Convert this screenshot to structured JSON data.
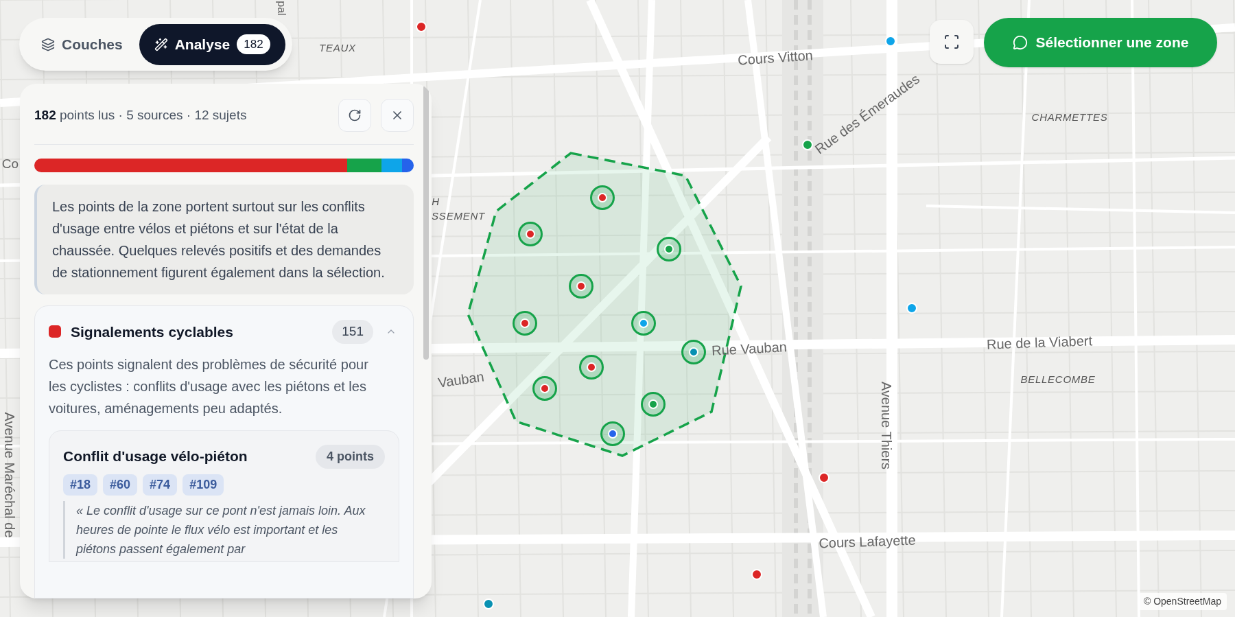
{
  "tabs": [
    {
      "kind": "layers",
      "label": "Couches",
      "selected": false
    },
    {
      "kind": "analysis",
      "label": "Analyse",
      "count": "182",
      "selected": true
    }
  ],
  "toolbar": {
    "select_zone": "Sélectionner une zone"
  },
  "map": {
    "labels": [
      {
        "text": "TEAUX",
        "kind": "district"
      },
      {
        "text": "pal",
        "kind": "street"
      },
      {
        "text": "Cours Vitton",
        "kind": "street"
      },
      {
        "text": "Rue des Émeraudes",
        "kind": "street"
      },
      {
        "text": "CHARMETTES",
        "kind": "district"
      },
      {
        "text": "Co",
        "kind": "street"
      },
      {
        "text": "H",
        "kind": "district"
      },
      {
        "text": "SSEMENT",
        "kind": "district"
      },
      {
        "text": "Vauban",
        "kind": "street"
      },
      {
        "text": "Rue Vauban",
        "kind": "street"
      },
      {
        "text": "Rue de la Viabert",
        "kind": "street"
      },
      {
        "text": "BELLECOMBE",
        "kind": "district"
      },
      {
        "text": "Avenue Thiers",
        "kind": "street"
      },
      {
        "text": "Cours Lafayette",
        "kind": "street"
      },
      {
        "text": "Avenue Maréchal de",
        "kind": "street"
      }
    ],
    "points": [
      {
        "color": "#dc2626",
        "selected": false
      },
      {
        "color": "#0ea5e9",
        "selected": false
      },
      {
        "color": "#16a34a",
        "selected": false
      },
      {
        "color": "#0ea5e9",
        "selected": false
      },
      {
        "color": "#dc2626",
        "selected": false
      },
      {
        "color": "#dc2626",
        "selected": false
      },
      {
        "color": "#0891b2",
        "selected": false
      },
      {
        "color": "#dc2626",
        "selected": true
      },
      {
        "color": "#dc2626",
        "selected": true
      },
      {
        "color": "#16a34a",
        "selected": true
      },
      {
        "color": "#dc2626",
        "selected": true
      },
      {
        "color": "#dc2626",
        "selected": true
      },
      {
        "color": "#0ea5e9",
        "selected": true
      },
      {
        "color": "#0891b2",
        "selected": true
      },
      {
        "color": "#dc2626",
        "selected": true
      },
      {
        "color": "#dc2626",
        "selected": true
      },
      {
        "color": "#16a34a",
        "selected": true
      },
      {
        "color": "#2563eb",
        "selected": true
      }
    ],
    "attribution": "© OpenStreetMap"
  },
  "panel": {
    "stats": "**182** points lus · 5 sources · 12 sujets",
    "segments": [
      {
        "color": "#dc2626"
      },
      {
        "color": "#16a34a"
      },
      {
        "color": "#0ea5e9"
      },
      {
        "color": "#2563eb"
      }
    ],
    "summary": "Les points de la zone portent surtout sur les conflits d'usage entre vélos et piétons et sur l'état de la chaussée. Quelques relevés positifs et des demandes de stationnement figurent également dans la sélection.",
    "categories": [
      {
        "title": "Signalements cyclables",
        "count": "151",
        "color": "#dc2626",
        "expanded": true,
        "description": "Ces points signalent des problèmes de sécurité pour les cyclistes : conflits d'usage avec les piétons et les voitures, aménagements peu adaptés.",
        "topics": [
          {
            "title": "Conflit d'usage vélo-piéton",
            "count": "4 points",
            "tags": [
              "#18",
              "#60",
              "#74",
              "#109"
            ],
            "quote": "« Le conflit d'usage sur ce pont n'est jamais loin. Aux heures de pointe le flux vélo est important et les piétons passent également par"
          }
        ]
      }
    ]
  }
}
